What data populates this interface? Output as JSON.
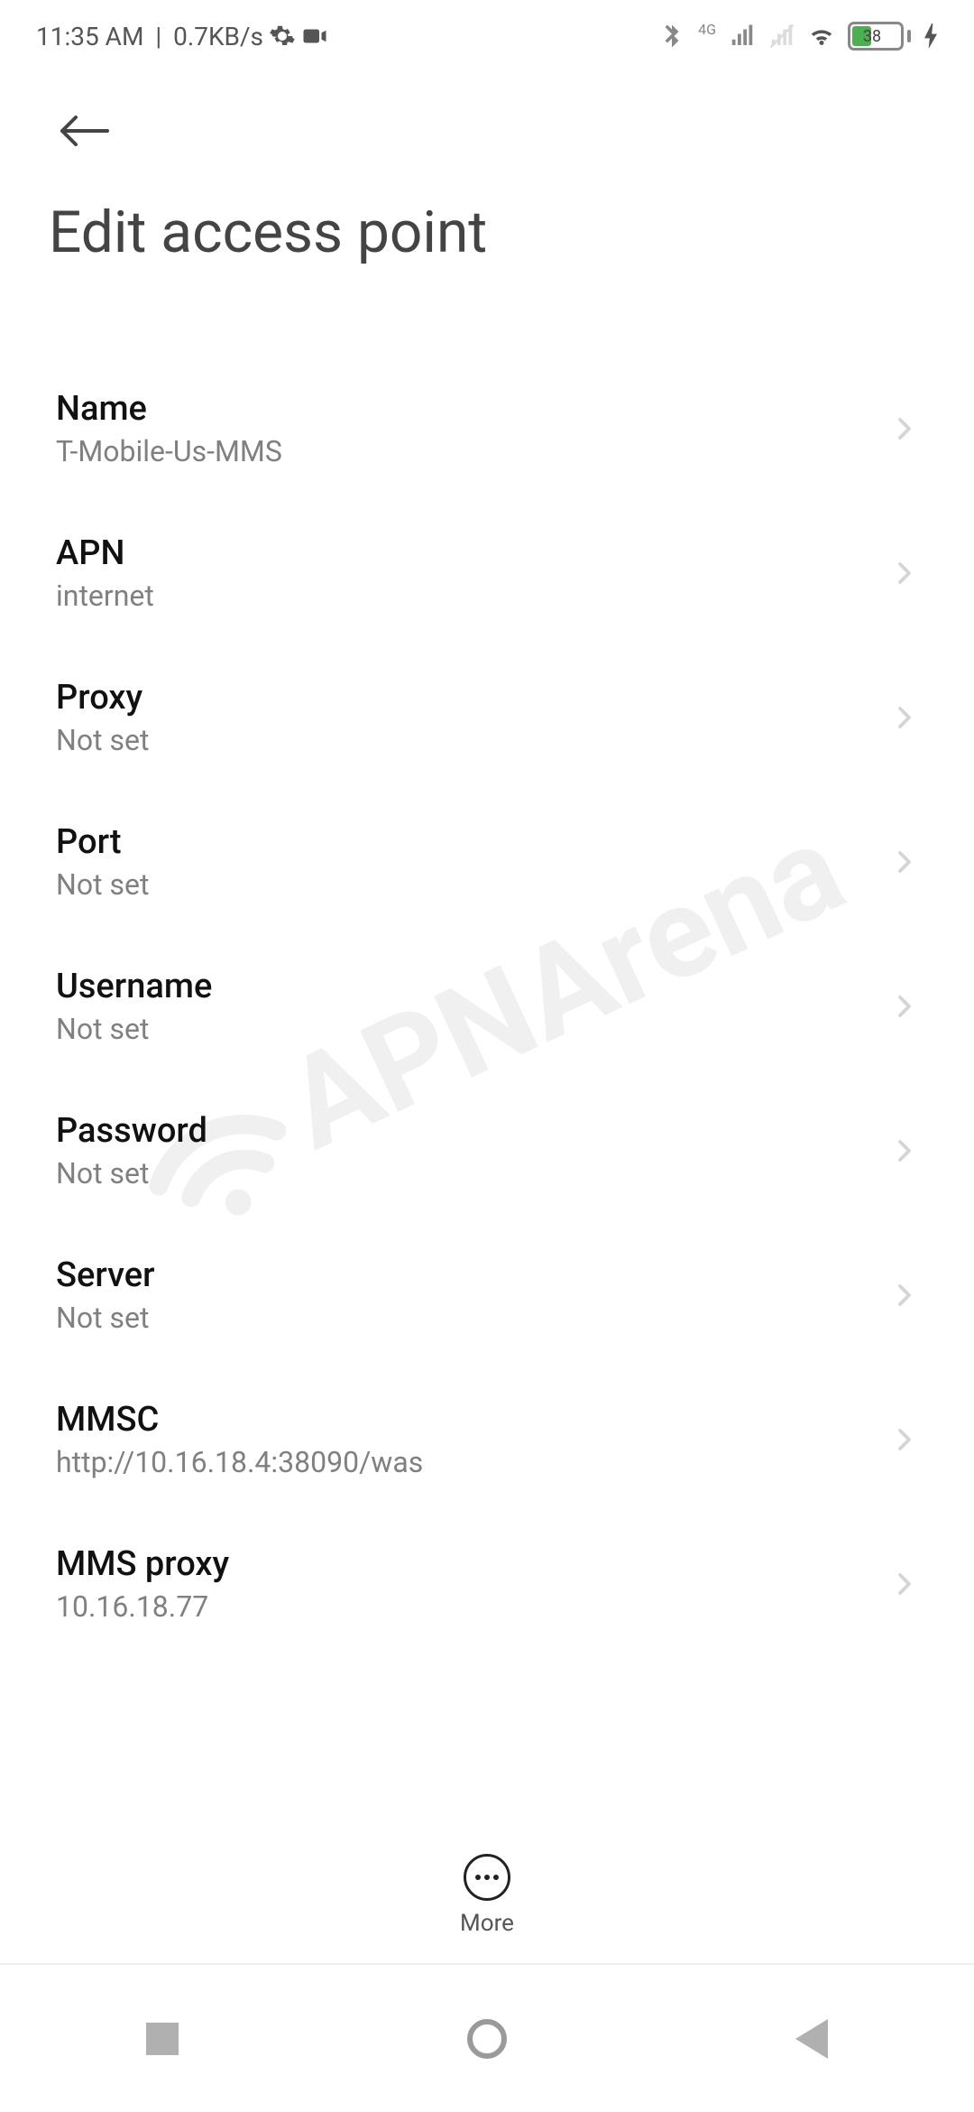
{
  "status": {
    "time": "11:35 AM",
    "speed": "0.7KB/s",
    "network_label": "4G",
    "battery_pct": "38"
  },
  "header": {
    "title": "Edit access point"
  },
  "settings": [
    {
      "label": "Name",
      "value": "T-Mobile-Us-MMS"
    },
    {
      "label": "APN",
      "value": "internet"
    },
    {
      "label": "Proxy",
      "value": "Not set"
    },
    {
      "label": "Port",
      "value": "Not set"
    },
    {
      "label": "Username",
      "value": "Not set"
    },
    {
      "label": "Password",
      "value": "Not set"
    },
    {
      "label": "Server",
      "value": "Not set"
    },
    {
      "label": "MMSC",
      "value": "http://10.16.18.4:38090/was"
    },
    {
      "label": "MMS proxy",
      "value": "10.16.18.77"
    }
  ],
  "bottom": {
    "more_label": "More"
  },
  "watermark": {
    "text": "APNArena"
  }
}
